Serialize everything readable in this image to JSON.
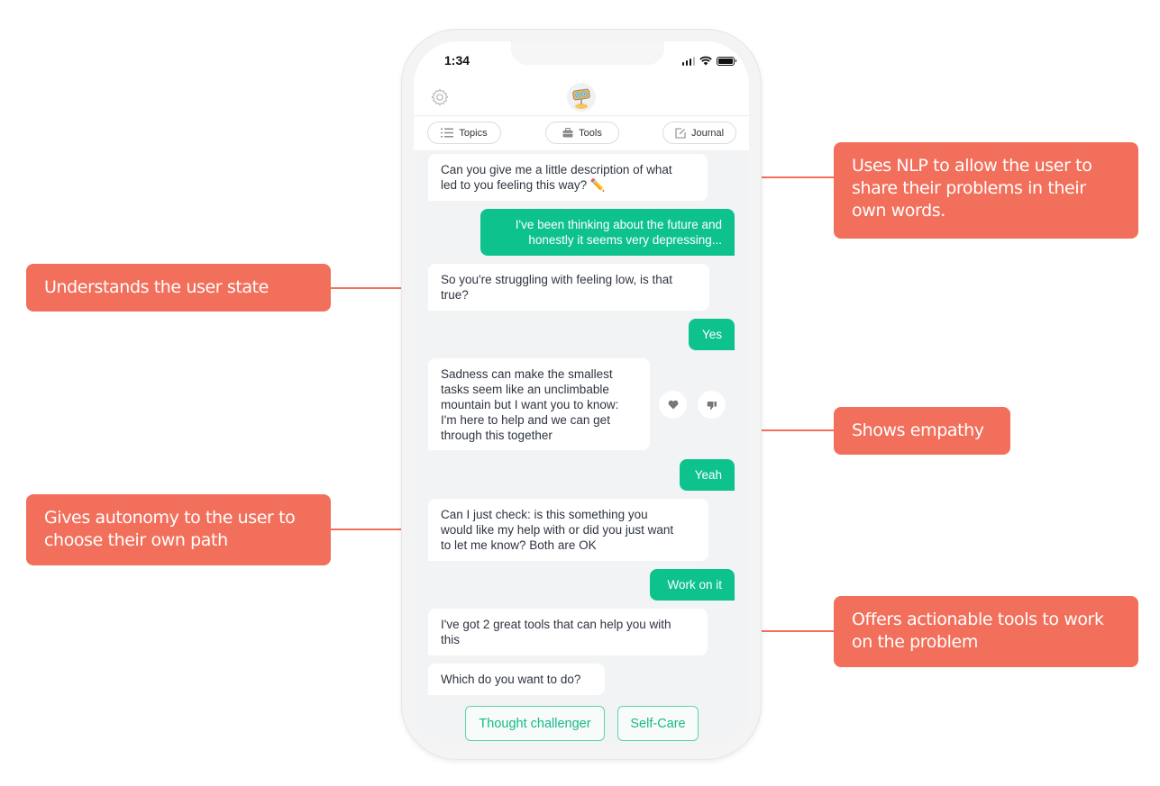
{
  "status_bar": {
    "time": "1:34",
    "icons": [
      "cellular-signal-icon",
      "wifi-icon",
      "battery-icon"
    ]
  },
  "header": {
    "settings_icon": "gear-icon",
    "avatar_icon": "robot-avatar-icon"
  },
  "nav_pills": [
    {
      "label": "Topics",
      "icon": "list-icon"
    },
    {
      "label": "Tools",
      "icon": "toolbox-icon"
    },
    {
      "label": "Journal",
      "icon": "edit-note-icon"
    }
  ],
  "messages": [
    {
      "sender": "bot",
      "lines": [
        "Can you give me a little description of what",
        "led to you feeling this way? ✏️"
      ]
    },
    {
      "sender": "user",
      "lines": [
        "I've been thinking about the future and",
        "honestly it seems very depressing..."
      ]
    },
    {
      "sender": "bot",
      "lines": [
        "So you're struggling with feeling low, is that",
        "true?"
      ]
    },
    {
      "sender": "user",
      "lines": [
        "Yes"
      ]
    },
    {
      "sender": "bot",
      "lines": [
        "Sadness can make the smallest",
        "tasks seem like an unclimbable",
        "mountain but I want you to know:",
        "I'm here to help and we can get",
        "through this together"
      ]
    },
    {
      "sender": "user",
      "lines": [
        "Yeah"
      ]
    },
    {
      "sender": "bot",
      "lines": [
        "Can I just check: is this something you",
        "would like my help with or did you just want",
        "to let me know? Both are OK"
      ]
    },
    {
      "sender": "user",
      "lines": [
        "Work on it"
      ]
    },
    {
      "sender": "bot",
      "lines": [
        "I've got 2 great tools that can help you with",
        "this"
      ]
    },
    {
      "sender": "bot",
      "lines": [
        "Which do you want to do?"
      ]
    }
  ],
  "reactions": {
    "like_icon": "heart-icon",
    "dislike_icon": "thumbs-down-icon"
  },
  "choices": [
    {
      "label": "Thought challenger"
    },
    {
      "label": "Self-Care"
    }
  ],
  "callouts": [
    {
      "id": "nlp",
      "text": "Uses NLP to allow the user to share their problems in their own words."
    },
    {
      "id": "user-state",
      "text": "Understands the user state"
    },
    {
      "id": "empathy",
      "text": "Shows empathy"
    },
    {
      "id": "autonomy",
      "text": "Gives autonomy to the user to choose their own path"
    },
    {
      "id": "tools",
      "text": "Offers actionable tools to work on the problem"
    }
  ],
  "colors": {
    "callout": "#f26f5b",
    "user_bubble": "#0ec28e",
    "chat_background": "#f2f3f5",
    "choice_border": "#5fd3b0"
  }
}
